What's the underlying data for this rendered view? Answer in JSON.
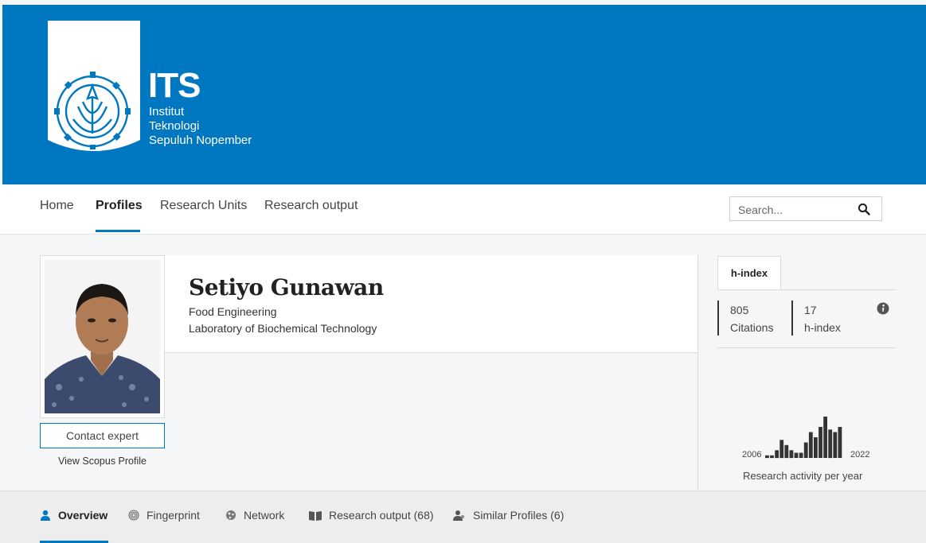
{
  "brand": {
    "abbrev": "ITS",
    "lines": [
      "Institut",
      "Teknologi",
      "Sepuluh Nopember"
    ],
    "color": "#0077c1"
  },
  "nav": {
    "items": [
      "Home",
      "Profiles",
      "Research Units",
      "Research output"
    ],
    "active": "Profiles"
  },
  "search": {
    "placeholder": "Search..."
  },
  "profile": {
    "name": "Setiyo Gunawan",
    "affiliations": [
      "Food Engineering",
      "Laboratory of Biochemical Technology"
    ],
    "contact_label": "Contact expert",
    "scopus_label": "View Scopus Profile"
  },
  "metrics": {
    "tab_label": "h-index",
    "items": [
      {
        "value": "805",
        "label": "Citations"
      },
      {
        "value": "17",
        "label": "h-index"
      }
    ]
  },
  "chart_data": {
    "type": "bar",
    "title": "",
    "caption": "Research activity per year",
    "x_start_label": "2006",
    "x_end_label": "2022",
    "categories": [
      "2006",
      "2007",
      "2008",
      "2009",
      "2010",
      "2011",
      "2012",
      "2013",
      "2014",
      "2015",
      "2016",
      "2017",
      "2018",
      "2019",
      "2020",
      "2021",
      "2022"
    ],
    "values": [
      1,
      1,
      3,
      7,
      5,
      3,
      2,
      2,
      6,
      10,
      8,
      12,
      16,
      11,
      10,
      12,
      0
    ],
    "ylim": [
      0,
      16
    ],
    "bar_color": "#333333"
  },
  "subtabs": [
    {
      "label": "Overview",
      "icon": "person-icon",
      "active": true
    },
    {
      "label": "Fingerprint",
      "icon": "fingerprint-icon",
      "active": false
    },
    {
      "label": "Network",
      "icon": "network-icon",
      "active": false
    },
    {
      "label": "Research output (68)",
      "icon": "book-icon",
      "active": false
    },
    {
      "label": "Similar Profiles (6)",
      "icon": "people-icon",
      "active": false
    }
  ]
}
